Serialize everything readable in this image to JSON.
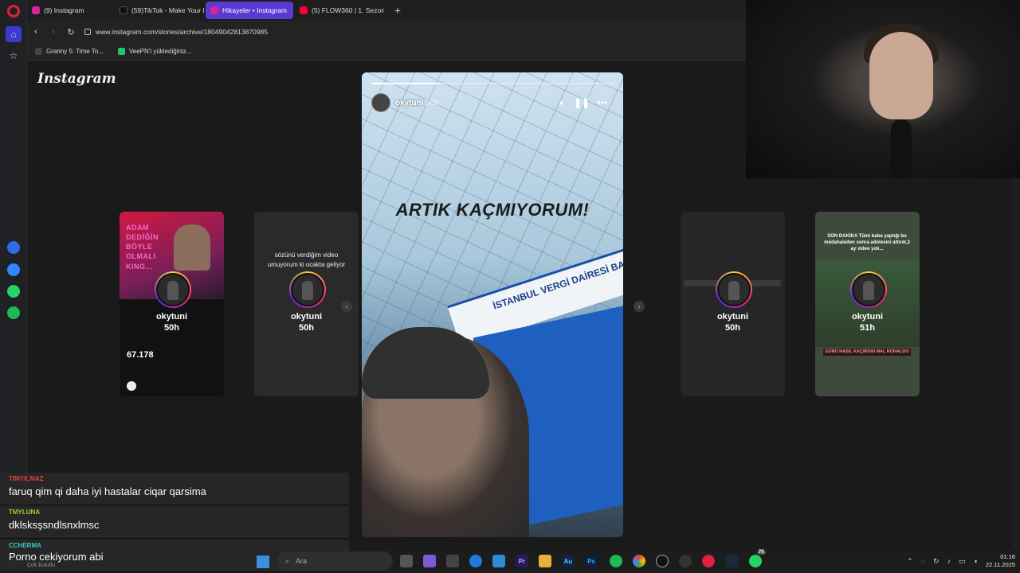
{
  "browser": {
    "tabs": [
      {
        "label": "(9) Instagram",
        "color": "#d6249f",
        "active": false
      },
      {
        "label": "(59)TikTok - Make Your Da",
        "color": "#111111",
        "active": false
      },
      {
        "label": "Hikayeler • Instagram",
        "color": "#d6249f",
        "active": true
      },
      {
        "label": "(5) FLOW360 | 1. Sezon 2.",
        "color": "#ff0033",
        "active": false
      }
    ],
    "new_tab_symbol": "+",
    "url": "www.instagram.com/stories/archive/18049042813870985",
    "bookmarks": [
      {
        "label": "Granny 5: Time To...",
        "icon_color": "#444444"
      },
      {
        "label": "VeePN'i yüklediğiniz...",
        "icon_color": "#26c26b"
      }
    ]
  },
  "instagram": {
    "logo": "Instagram",
    "cards": [
      {
        "user": "okytuni",
        "age": "50h",
        "text": "ADAM DEDİĞİN BÖYLE OLMALI KING...",
        "count": "67.178"
      },
      {
        "user": "okytuni",
        "age": "50h",
        "text": "sözünü verdiğim video umuyorum ki ocakta geliyor"
      },
      {
        "user": "okytuni",
        "age": "50h"
      },
      {
        "user": "okytuni",
        "age": "51h",
        "text": "SON DAKİKA Tümi baba yaptığı bu müdahaleden sonra adolesini attırdı,3 ay video yok...",
        "badge": "GÜNÜ NASIL KAÇIRDIN MAL RONALDO"
      }
    ],
    "story": {
      "user": "okytuni",
      "age": "50h",
      "headline": "ARTIK KAÇMIYORUM!",
      "sign_text": "İSTANBUL VERGİ DAİRESİ BAŞKAN",
      "progress": 0.28
    }
  },
  "chat": [
    {
      "user": "TIMYILMAZ",
      "text": "faruq qim qi daha iyi hastalar ciqar qarsima",
      "color": "#e04040"
    },
    {
      "user": "TMYLUNA",
      "text": "dklsksşsndlsnxlmsc",
      "color": "#9ad13a"
    },
    {
      "user": "CCHERMA",
      "text": "Porno cekiyorum abi",
      "color": "#3ac8c0"
    }
  ],
  "taskbar": {
    "search_placeholder": "Ara",
    "weather": "Çok bulutlu",
    "time": "01:16",
    "date": "22.11.2025",
    "badge_count": "75"
  }
}
